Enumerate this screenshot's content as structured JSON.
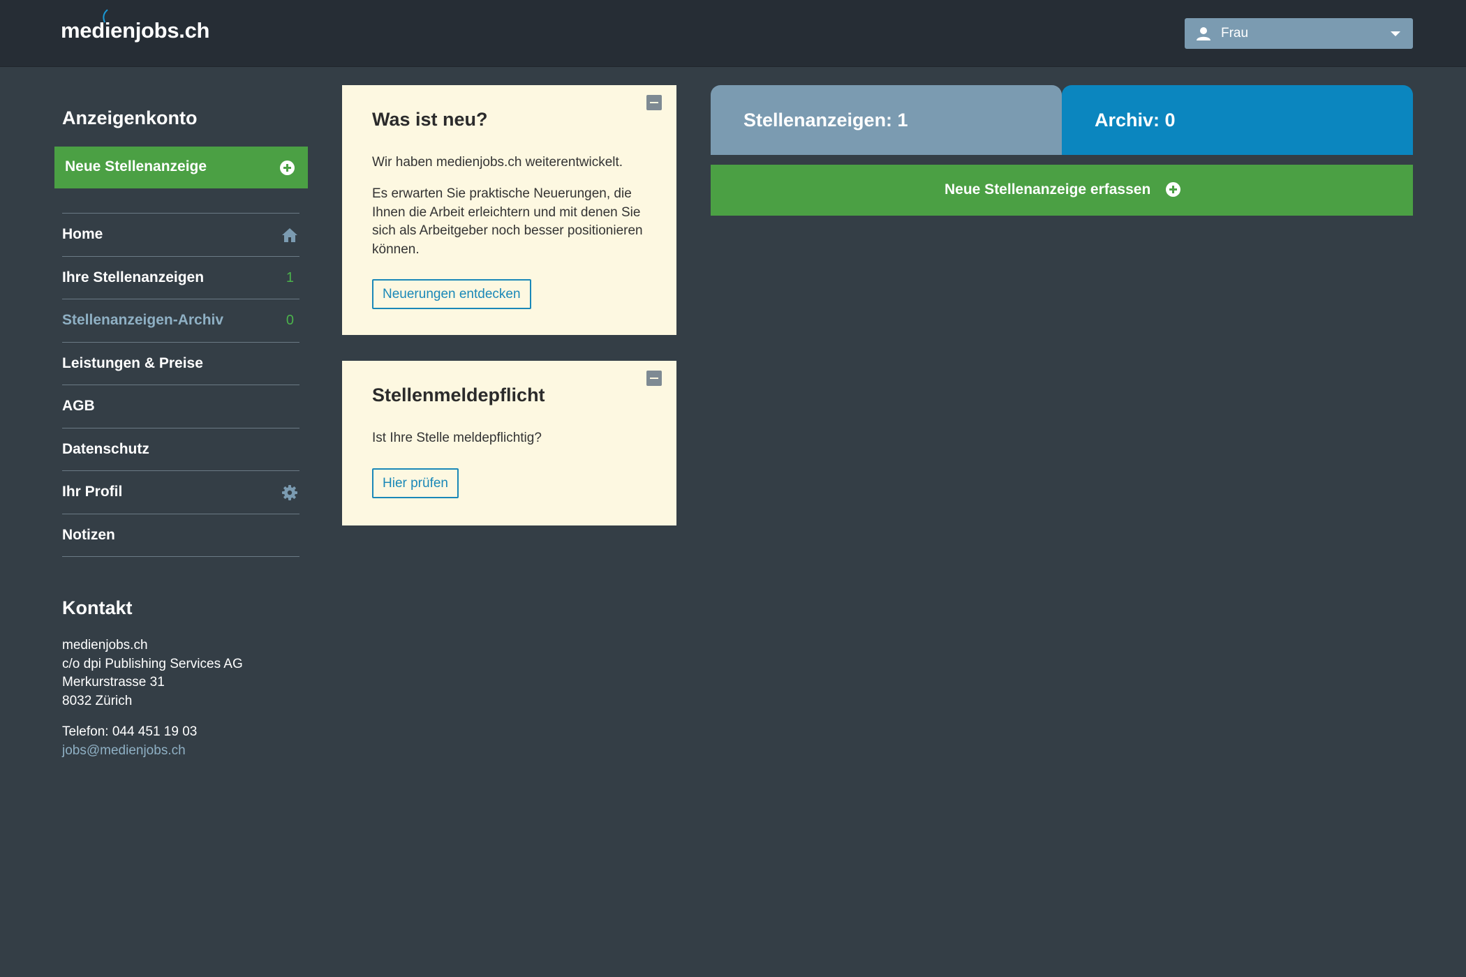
{
  "header": {
    "logo": "medienjobs.ch",
    "user_menu": {
      "label": "Frau",
      "icon": "user-icon"
    }
  },
  "sidebar": {
    "title": "Anzeigenkonto",
    "new_ad_label": "Neue Stellenanzeige",
    "items": [
      {
        "label": "Home",
        "icon": "home-icon"
      },
      {
        "label": "Ihre Stellenanzeigen",
        "count": "1"
      },
      {
        "label": "Stellenanzeigen-Archiv",
        "count": "0",
        "active": true
      },
      {
        "label": "Leistungen & Preise"
      },
      {
        "label": "AGB"
      },
      {
        "label": "Datenschutz"
      },
      {
        "label": "Ihr Profil",
        "icon": "gear-icon"
      },
      {
        "label": "Notizen"
      }
    ]
  },
  "contact": {
    "title": "Kontakt",
    "lines": [
      "medienjobs.ch",
      "c/o dpi Publishing Services AG",
      "Merkurstrasse 31",
      "8032 Zürich"
    ],
    "phone": "Telefon: 044 451 19 03",
    "email": "jobs@medienjobs.ch"
  },
  "cards": [
    {
      "title": "Was ist neu?",
      "paragraphs": [
        "Wir haben medienjobs.ch weiterentwickelt.",
        "Es erwarten Sie praktische Neuerungen, die Ihnen die Arbeit erleichtern und mit denen Sie sich als Arbeitgeber noch besser positionieren können."
      ],
      "button": "Neuerungen entdecken"
    },
    {
      "title": "Stellenmeldepflicht",
      "paragraphs": [
        "Ist Ihre Stelle meldepflichtig?"
      ],
      "button": "Hier prüfen"
    }
  ],
  "stats": {
    "ads_label": "Stellenanzeigen: 1",
    "archive_label": "Archiv: 0"
  },
  "main": {
    "create_button": "Neue Stellenanzeige erfassen"
  },
  "colors": {
    "background": "#343e46",
    "header": "#262d35",
    "green": "#4ba044",
    "blue": "#0b86bf",
    "slate": "#7b9bb1",
    "card": "#fdf8e1"
  }
}
